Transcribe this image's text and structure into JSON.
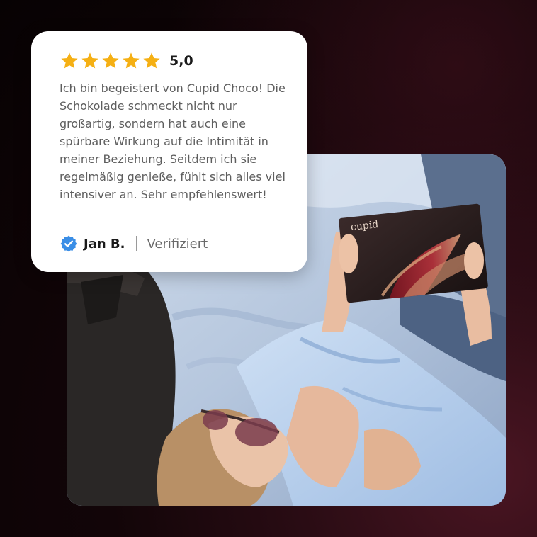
{
  "review": {
    "rating_display": "5,0",
    "star_count": 5,
    "star_color": "#f5b014",
    "text": "Ich bin begeistert von Cupid Choco! Die Schokolade schmeckt nicht nur großartig, sondern hat auch eine spürbare Wirkung auf die Intimität in meiner Beziehung. Seitdem ich sie regelmäßig genieße, fühlt sich alles viel intensiver an. Sehr empfehlenswert!",
    "author": "Jan B.",
    "status": "Verifiziert",
    "badge_color": "#3a8ee6"
  },
  "photo": {
    "product_brand": "cupid"
  }
}
